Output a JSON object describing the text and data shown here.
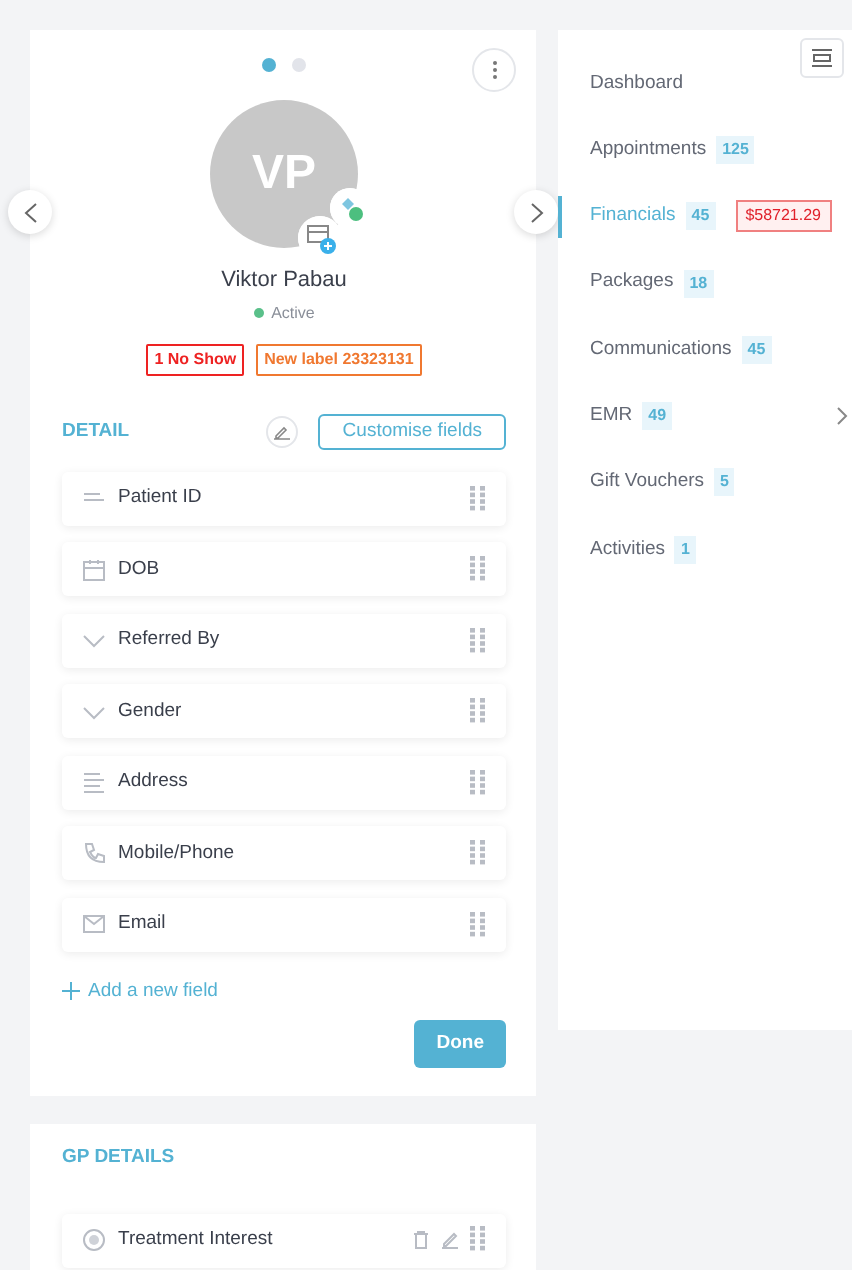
{
  "carousel": {
    "dots": [
      {
        "selected": true
      },
      {
        "selected": false
      }
    ]
  },
  "profile": {
    "initials": "VP",
    "name": "Viktor Pabau",
    "status": "Active",
    "active": true,
    "labels": [
      {
        "text": "1 No Show",
        "color": "#ee2222"
      },
      {
        "text": "New label 23323131",
        "color": "#f07830"
      }
    ]
  },
  "detail": {
    "title": "DETAIL",
    "customise_button": "Customise fields",
    "fields": [
      {
        "kind": "text",
        "label": "Patient ID"
      },
      {
        "kind": "date",
        "label": "DOB"
      },
      {
        "kind": "dropdown",
        "label": "Referred By"
      },
      {
        "kind": "dropdown",
        "label": "Gender"
      },
      {
        "kind": "address",
        "label": "Address"
      },
      {
        "kind": "phone",
        "label": "Mobile/Phone"
      },
      {
        "kind": "email",
        "label": "Email"
      }
    ],
    "add_field": "Add a new field",
    "done_button": "Done"
  },
  "gp_details": {
    "title": "GP DETAILS",
    "fields": [
      {
        "kind": "radio",
        "label": "Treatment Interest",
        "actions": true
      }
    ]
  },
  "nav": {
    "items": [
      {
        "label": "Dashboard",
        "selected": false
      },
      {
        "label": "Appointments",
        "count": "125",
        "selected": false
      },
      {
        "label": "Financials",
        "count": "45",
        "amount": "$58721.29",
        "selected": true
      },
      {
        "label": "Packages",
        "count": "18",
        "selected": false
      },
      {
        "label": "Communications",
        "count": "45",
        "selected": false
      },
      {
        "label": "EMR",
        "count": "49",
        "selected": false,
        "expandable": true
      },
      {
        "label": "Gift Vouchers",
        "count": "5",
        "selected": false
      },
      {
        "label": "Activities",
        "count": "1",
        "selected": false
      }
    ]
  }
}
